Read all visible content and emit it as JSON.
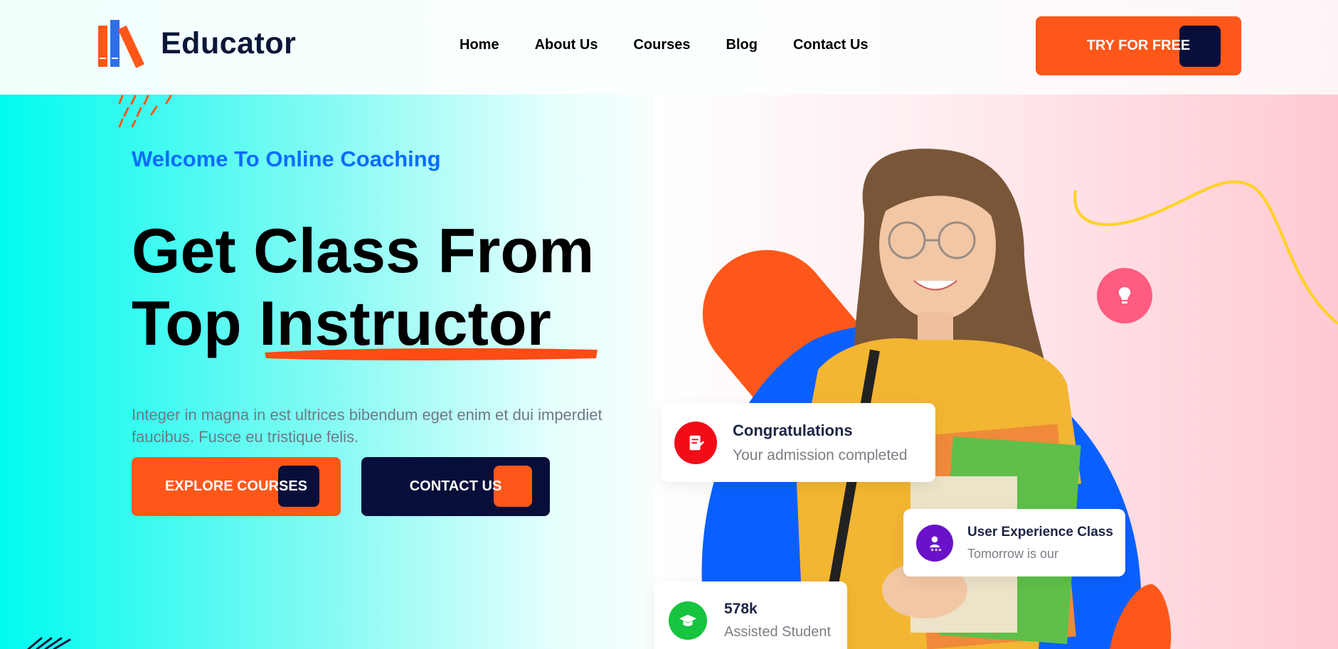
{
  "brand": {
    "name": "Educator",
    "logo_colors": [
      "#ff5719",
      "#2f6fe8",
      "#ff5719"
    ]
  },
  "nav": {
    "items": [
      {
        "label": "Home"
      },
      {
        "label": "About Us"
      },
      {
        "label": "Courses"
      },
      {
        "label": "Blog"
      },
      {
        "label": "Contact Us"
      }
    ],
    "cta_label": "TRY FOR FREE"
  },
  "hero": {
    "welcome": "Welcome To Online Coaching",
    "title_line1": "Get Class From",
    "title_line2": "Top Instructor",
    "description": "Integer in magna in est ultrices bibendum eget enim et dui imperdiet faucibus. Fusce eu tristique felis.",
    "explore_label": "EXPLORE COURSES",
    "contact_label": "CONTACT US"
  },
  "cards": {
    "congrats": {
      "title": "Congratulations",
      "subtitle": "Your admission completed",
      "icon": "certificate-icon"
    },
    "ux_class": {
      "title": "User Experience Class",
      "subtitle": "Tomorrow is our",
      "icon": "user-rating-icon"
    },
    "students": {
      "title": "578k",
      "subtitle": "Assisted Student",
      "icon": "graduation-cap-icon"
    }
  },
  "decor": {
    "bulb_icon": "lightbulb-icon"
  },
  "colors": {
    "accent_orange": "#ff5719",
    "navy": "#070e3a",
    "welcome_blue": "#0a6cff",
    "cyan": "#00fbef",
    "pink": "#ffc9d2"
  }
}
